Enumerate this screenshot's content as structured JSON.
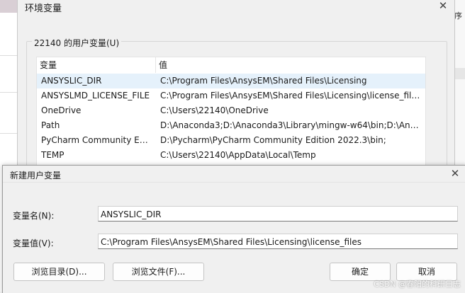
{
  "background": {
    "right_edge_text": "序"
  },
  "env_window": {
    "title": "环境变量",
    "user_vars_group_label": "22140 的用户变量(U)",
    "columns": [
      "变量",
      "值"
    ],
    "rows": [
      {
        "name": "ANSYSLIC_DIR",
        "value": "C:\\Program Files\\AnsysEM\\Shared Files\\Licensing",
        "selected": true
      },
      {
        "name": "ANSYSLMD_LICENSE_FILE",
        "value": "C:\\Program Files\\AnsysEM\\Shared Files\\Licensing\\license_file...",
        "selected": false
      },
      {
        "name": "OneDrive",
        "value": "C:\\Users\\22140\\OneDrive",
        "selected": false
      },
      {
        "name": "Path",
        "value": "D:\\Anaconda3;D:\\Anaconda3\\Library\\mingw-w64\\bin;D:\\Anac...",
        "selected": false
      },
      {
        "name": "PyCharm Community Editi...",
        "value": "D:\\Pycharm\\PyCharm Community Edition 2022.3\\bin;",
        "selected": false
      },
      {
        "name": "TEMP",
        "value": "C:\\Users\\22140\\AppData\\Local\\Temp",
        "selected": false
      }
    ]
  },
  "new_var_dialog": {
    "title": "新建用户变量",
    "name_label": "变量名(N):",
    "name_value": "ANSYSLIC_DIR",
    "value_label": "变量值(V):",
    "value_value": "C:\\Program Files\\AnsysEM\\Shared Files\\Licensing\\license_files",
    "browse_dir_label": "浏览目录(D)...",
    "browse_file_label": "浏览文件(F)...",
    "ok_label": "确定",
    "cancel_label": "取消"
  },
  "watermark": "CSDN @春阳的科研日志",
  "icons": {
    "close": "close-icon"
  },
  "colors": {
    "selected_row": "#e5f1fb",
    "dialog_bg": "#f0f0f0"
  }
}
